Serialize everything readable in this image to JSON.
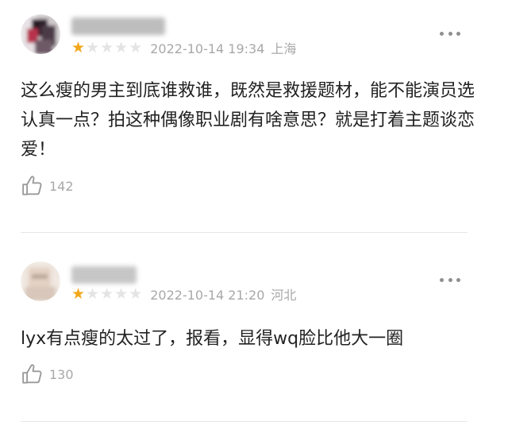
{
  "colors": {
    "star_active": "#f2a71b",
    "star_inactive": "#e4e4e4",
    "meta_text": "#a8a8a8",
    "body_text": "#222222",
    "divider": "#e6e6e6"
  },
  "comments": [
    {
      "username_blurred": true,
      "rating": 1,
      "rating_max": 5,
      "date": "2022-10-14 19:34",
      "location": "上海",
      "text": "这么瘦的男主到底谁救谁，既然是救援题材，能不能演员选认真一点？拍这种偶像职业剧有啥意思？就是打着主题谈恋爱！",
      "likes": "142",
      "icons": {
        "more": "more-dots-icon",
        "like": "thumbs-up-icon"
      }
    },
    {
      "username_blurred": true,
      "rating": 1,
      "rating_max": 5,
      "date": "2022-10-14 21:20",
      "location": "河北",
      "text": "lyx有点瘦的太过了，报看，显得wq脸比他大一圈",
      "likes": "130",
      "icons": {
        "more": "more-dots-icon",
        "like": "thumbs-up-icon"
      }
    }
  ]
}
